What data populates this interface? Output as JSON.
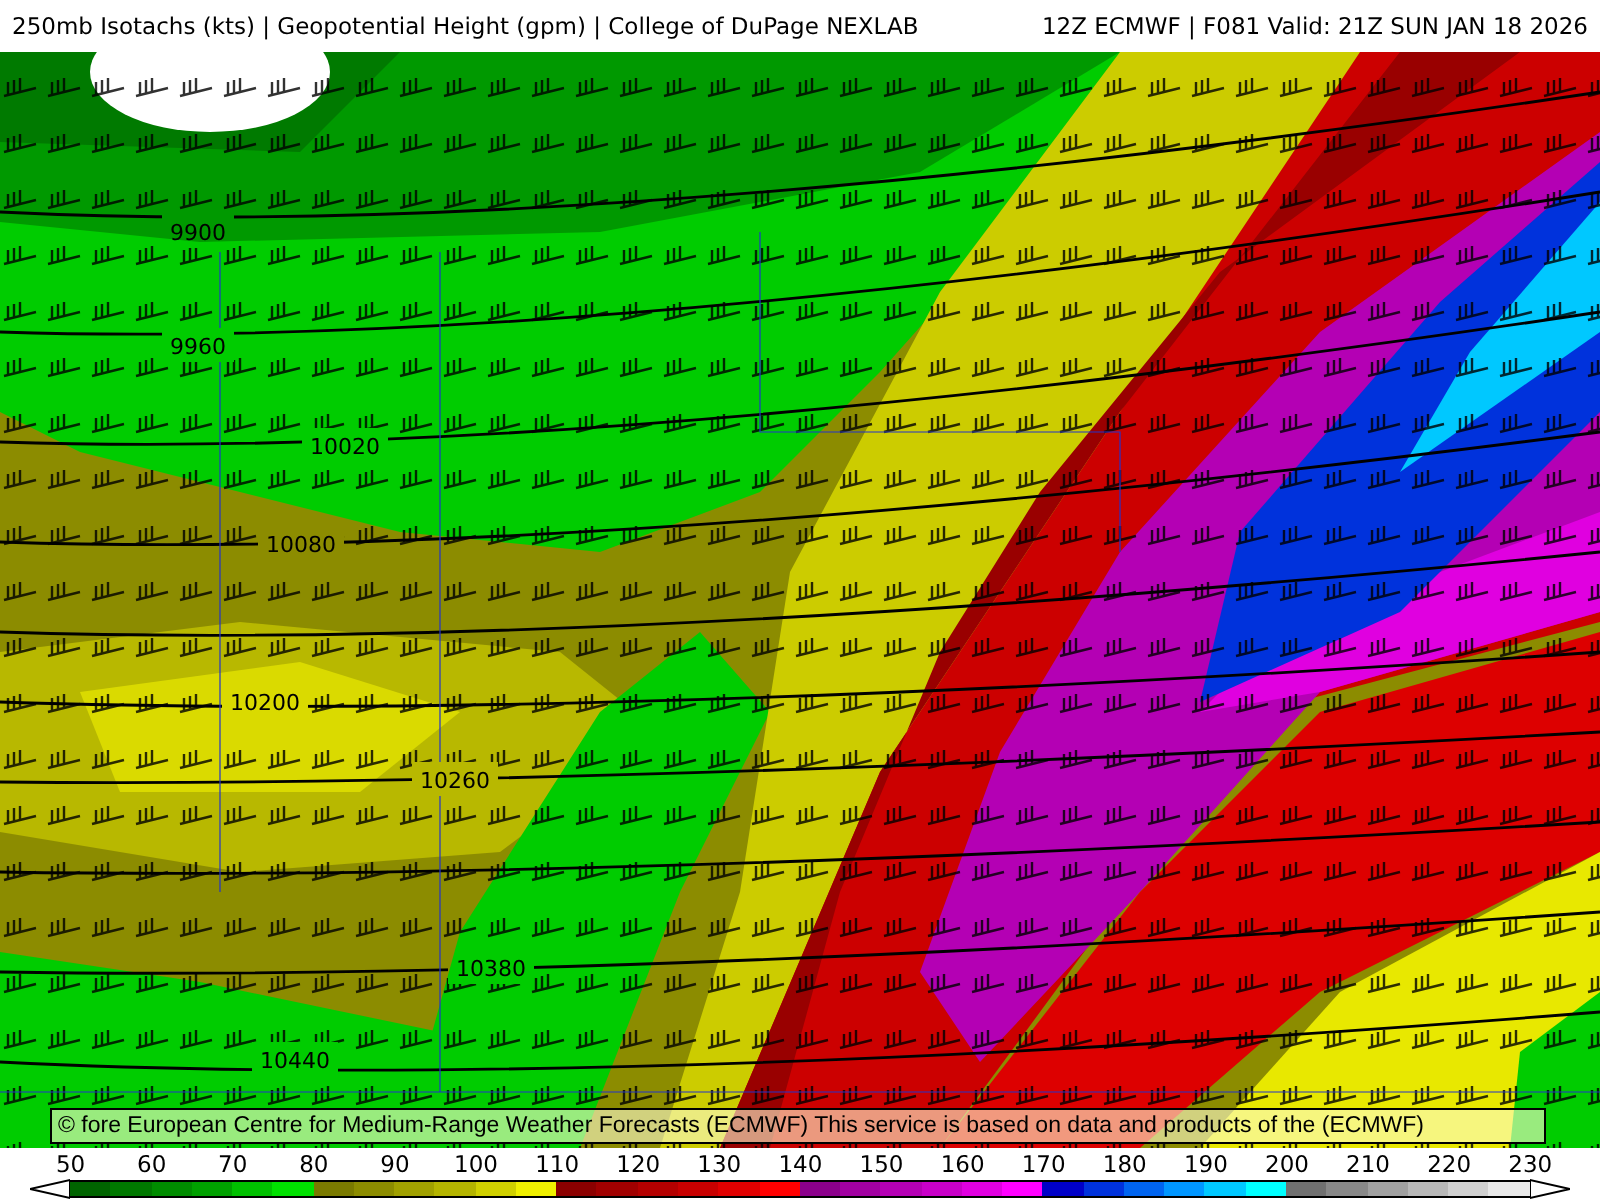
{
  "header": {
    "title": "250mb Isotachs (kts) | Geopotential Height (gpm) | College of DuPage NEXLAB",
    "run": "12Z ECMWF | F081 Valid: 21Z SUN JAN 18 2026"
  },
  "map": {
    "contour_labels": [
      "9900",
      "9960",
      "10020",
      "10080",
      "10200",
      "10260",
      "10380",
      "10440"
    ],
    "attribution": "© fore European Centre for Medium-Range Weather Forecasts (ECMWF)  This service is based on data and products of the (ECMWF)"
  },
  "legend": {
    "labels": [
      "50",
      "60",
      "70",
      "80",
      "90",
      "100",
      "110",
      "120",
      "130",
      "140",
      "150",
      "160",
      "170",
      "180",
      "190",
      "200",
      "210",
      "220",
      "230"
    ],
    "swatches": [
      {
        "color": "#006400"
      },
      {
        "color": "#007800"
      },
      {
        "color": "#008c00"
      },
      {
        "color": "#00a000"
      },
      {
        "color": "#00c000"
      },
      {
        "color": "#00e000"
      },
      {
        "color": "#7a7a00"
      },
      {
        "color": "#8c8c00"
      },
      {
        "color": "#a0a000"
      },
      {
        "color": "#b4b400"
      },
      {
        "color": "#d0d000"
      },
      {
        "color": "#f0f000"
      },
      {
        "color": "#8b0000"
      },
      {
        "color": "#a00000"
      },
      {
        "color": "#b40000"
      },
      {
        "color": "#c80000"
      },
      {
        "color": "#e00000"
      },
      {
        "color": "#ff0000"
      },
      {
        "color": "#8b008b"
      },
      {
        "color": "#a000a0"
      },
      {
        "color": "#b400b4"
      },
      {
        "color": "#c800c8"
      },
      {
        "color": "#e000e0"
      },
      {
        "color": "#ff00ff"
      },
      {
        "color": "#0000c8"
      },
      {
        "color": "#0032dc"
      },
      {
        "color": "#0064f0"
      },
      {
        "color": "#0096ff"
      },
      {
        "color": "#00c8ff"
      },
      {
        "color": "#00ffff"
      },
      {
        "color": "#707070"
      },
      {
        "color": "#888888"
      },
      {
        "color": "#a0a0a0"
      },
      {
        "color": "#b8b8b8"
      },
      {
        "color": "#d0d0d0"
      },
      {
        "color": "#e8e8e8"
      }
    ]
  }
}
